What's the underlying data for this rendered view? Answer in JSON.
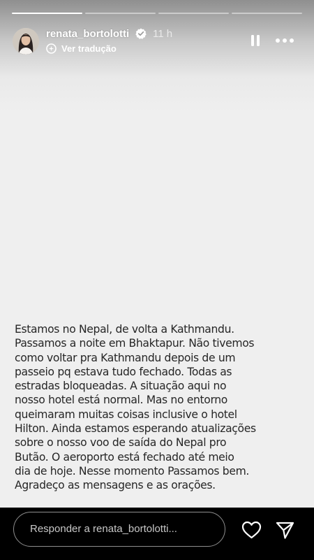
{
  "story": {
    "progress": {
      "segments": 4,
      "active_index": 0
    },
    "author": {
      "username": "renata_bortolotti",
      "verified": true,
      "time_ago": "11 h",
      "avatar_icon": "avatar-photo"
    },
    "translate": {
      "label": "Ver tradução",
      "icon": "translate-sparkle-icon"
    },
    "controls": {
      "pause_icon": "pause-icon",
      "more_icon": "more-horizontal-icon"
    },
    "text": "Estamos no Nepal, de volta a Kathmandu.\nPassamos a noite em Bhaktapur. Não tivemos\ncomo voltar pra Kathmandu depois de um\npasseio pq estava tudo fechado. Todas as\nestradas bloqueadas. A situação aqui no\nnosso hotel está normal. Mas no entorno\nqueimaram muitas coisas inclusive o hotel\nHilton. Ainda estamos esperando atualizações\nsobre o nosso voo de saída do Nepal pro\nButão. O aeroporto está fechado até meio\ndia de hoje. Nesse momento Passamos bem.\nAgradeço as mensagens e as orações.",
    "background_color": "#efefef"
  },
  "reply": {
    "placeholder": "Responder a renata_bortolotti...",
    "like_icon": "heart-outline-icon",
    "share_icon": "paper-plane-icon"
  },
  "colors": {
    "text_dark": "#262626",
    "white": "#ffffff",
    "verified_badge": "#ffffff",
    "input_border": "#8e8e8e"
  }
}
